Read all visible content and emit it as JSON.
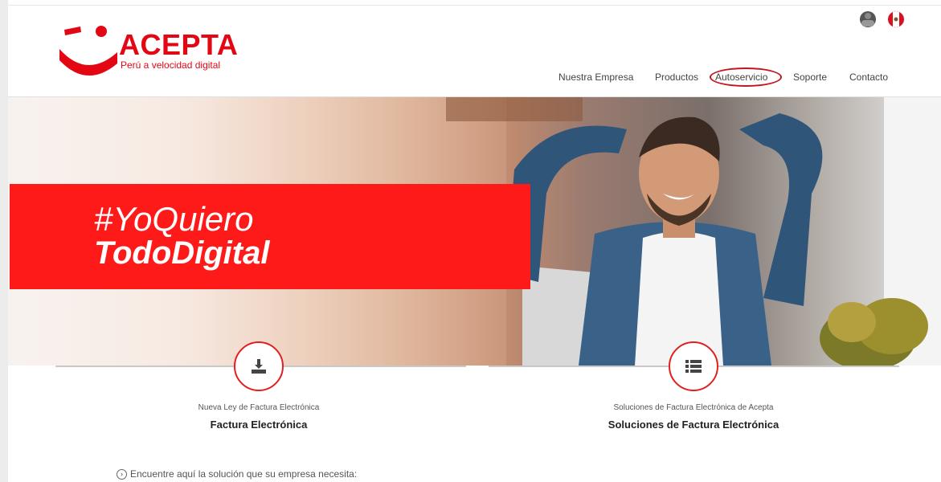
{
  "brand": {
    "name": "ACEPTA",
    "tagline": "Perú a velocidad digital",
    "color": "#e30613"
  },
  "nav": {
    "items": [
      {
        "label": "Nuestra Empresa"
      },
      {
        "label": "Productos"
      },
      {
        "label": "Autoservicio",
        "highlighted": true
      },
      {
        "label": "Soporte"
      },
      {
        "label": "Contacto"
      }
    ]
  },
  "top_icons": [
    "user-icon",
    "peru-flag-icon"
  ],
  "hero": {
    "line1": "#YoQuiero",
    "line2": "TodoDigital",
    "banner_color": "#ff1a1a"
  },
  "features": [
    {
      "icon": "download-icon",
      "subtitle": "Nueva Ley de Factura Electrónica",
      "title": "Factura Electrónica"
    },
    {
      "icon": "list-icon",
      "subtitle": "Soluciones de Factura Electrónica de Acepta",
      "title": "Soluciones de Factura Electrónica"
    }
  ],
  "cta": {
    "icon": "chevron-right-circle-icon",
    "text": "Encuentre aquí la solución que su empresa necesita:"
  }
}
